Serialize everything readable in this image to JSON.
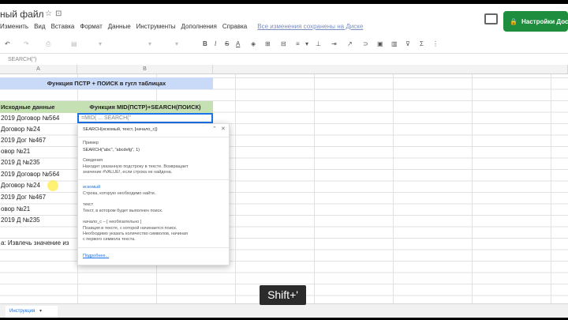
{
  "window": {
    "title": "ный файл"
  },
  "menu": [
    "Изменить",
    "Вид",
    "Вставка",
    "Формат",
    "Данные",
    "Инструменты",
    "Дополнения",
    "Справка"
  ],
  "unsaved_note": "Все изменения сохранены на Диске",
  "share_button": "Настройки Досту",
  "formula_bar": "SEARCH(\")",
  "columns": [
    "A",
    "B"
  ],
  "sheet": {
    "title": "Функция ПСТР + ПОИСК в гугл таблицах",
    "col_a_header": "Исходные данные",
    "col_b_header": "Функция MID(ПСТР)+SEARCH(ПОИСК)",
    "active_cell_text": "=MID( ... SEARCH(\"",
    "rows": [
      "2019 Договор №564",
      "Договор №24",
      "2019 Дог №467",
      "овор №21",
      "2019 Д №235",
      "2019 Договор №564",
      "Договор №24",
      "2019 Дог №467",
      "овор №21",
      "2019 Д №235"
    ],
    "note": "а: Извлечь значение из"
  },
  "popup": {
    "syntax": "SEARCH(искомый, текст, [начало_с])",
    "example_label": "Пример",
    "example": "SEARCH(\"abc\", \"abcdefg\", 1)",
    "summary_label": "Сведения",
    "summary_1": "Находит указанную подстроку в тексте. Возвращает",
    "summary_2": "значение #VALUE!, если строка не найдена.",
    "arg1": "искомый",
    "arg1_desc": "Строка, которую необходимо найти.",
    "arg2": "текст",
    "arg2_desc": "Текст, в котором будет выполнен поиск.",
    "arg3": "начало_с – [ необязательно ]",
    "arg3_desc_1": "Позиция в тексте, с которой начинается поиск.",
    "arg3_desc_2": "Необходимо указать количество символов, начиная",
    "arg3_desc_3": "с первого символа текста.",
    "more": "Подробнее..."
  },
  "tooltip": "Shift+'",
  "sheet_tab": "Инструкция"
}
